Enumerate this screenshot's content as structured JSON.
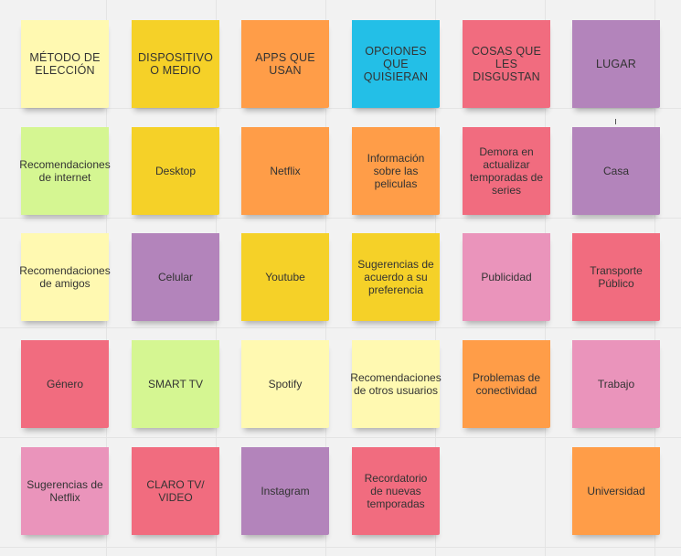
{
  "board": {
    "columns": [
      {
        "header": {
          "text": "MÉTODO DE ELECCIÓN",
          "color": "#fff9b1"
        },
        "notes": [
          {
            "text": "Recomendaciones de internet",
            "color": "#d5f692"
          },
          {
            "text": "Recomendaciones de amigos",
            "color": "#fff9b1"
          },
          {
            "text": "Género",
            "color": "#f16c7f"
          },
          {
            "text": "Sugerencias de Netflix",
            "color": "#ea94bb"
          }
        ]
      },
      {
        "header": {
          "text": "DISPOSITIVO O MEDIO",
          "color": "#f5d128"
        },
        "notes": [
          {
            "text": "Desktop",
            "color": "#f5d128"
          },
          {
            "text": "Celular",
            "color": "#b384bb"
          },
          {
            "text": "SMART TV",
            "color": "#d5f692"
          },
          {
            "text": "CLARO TV/ VIDEO",
            "color": "#f16c7f"
          }
        ]
      },
      {
        "header": {
          "text": "APPS QUE USAN",
          "color": "#ff9d48"
        },
        "notes": [
          {
            "text": "Netflix",
            "color": "#ff9d48"
          },
          {
            "text": "Youtube",
            "color": "#f5d128"
          },
          {
            "text": "Spotify",
            "color": "#fff9b1"
          },
          {
            "text": "Instagram",
            "color": "#b384bb"
          }
        ]
      },
      {
        "header": {
          "text": "OPCIONES QUE QUISIERAN",
          "color": "#23bfe7"
        },
        "notes": [
          {
            "text": "Información sobre las peliculas",
            "color": "#ff9d48"
          },
          {
            "text": "Sugerencias de acuerdo a su preferencia",
            "color": "#f5d128"
          },
          {
            "text": "Recomendaciones de otros usuarios",
            "color": "#fff9b1"
          },
          {
            "text": "Recordatorio de nuevas temporadas",
            "color": "#f16c7f"
          }
        ]
      },
      {
        "header": {
          "text": "COSAS QUE LES DISGUSTAN",
          "color": "#f16c7f"
        },
        "notes": [
          {
            "text": "Demora en actualizar temporadas de series",
            "color": "#f16c7f"
          },
          {
            "text": "Publicidad",
            "color": "#ea94bb"
          },
          {
            "text": "Problemas de conectividad",
            "color": "#ff9d48"
          }
        ]
      },
      {
        "header": {
          "text": "LUGAR",
          "color": "#b384bb"
        },
        "notes": [
          {
            "text": "Casa",
            "color": "#b384bb"
          },
          {
            "text": "Transporte Público",
            "color": "#f16c7f"
          },
          {
            "text": "Trabajo",
            "color": "#ea94bb"
          },
          {
            "text": "Universidad",
            "color": "#ff9d48"
          }
        ]
      }
    ]
  }
}
